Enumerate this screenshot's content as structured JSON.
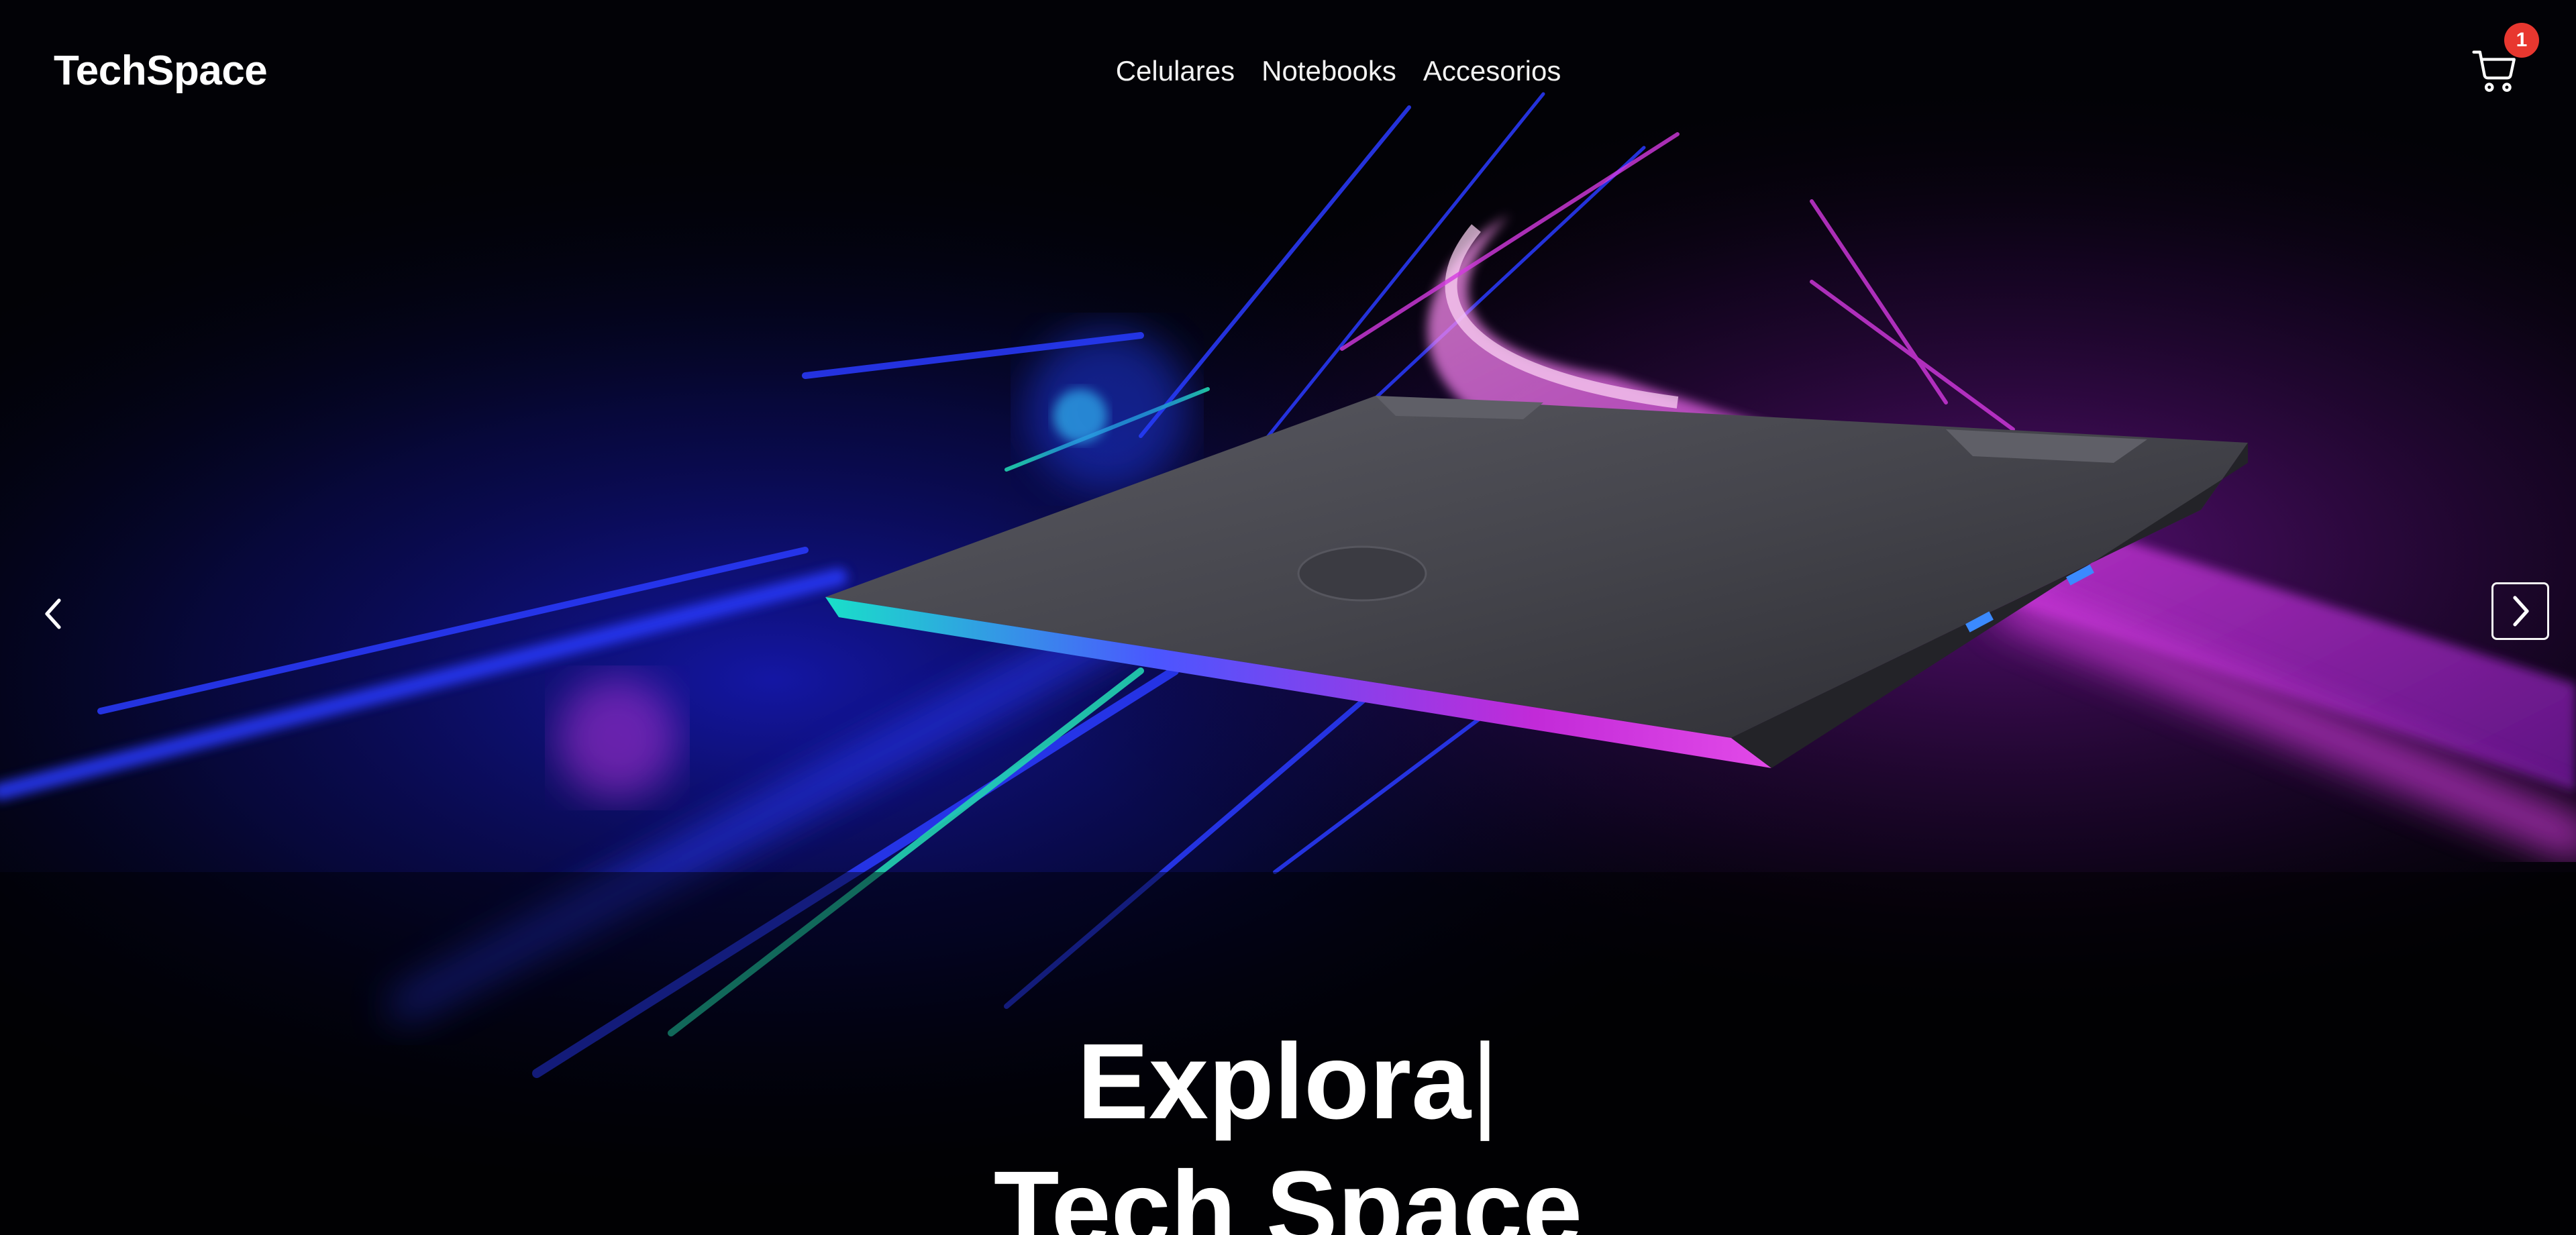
{
  "header": {
    "brand": "TechSpace",
    "nav": [
      "Celulares",
      "Notebooks",
      "Accesorios"
    ],
    "cart_count": "1"
  },
  "hero": {
    "line1": "Explora",
    "caret": "|",
    "line2": "Tech Space"
  },
  "icons": {
    "cart": "cart-icon",
    "prev": "chevron-left-icon",
    "next": "chevron-right-icon"
  },
  "colors": {
    "background": "#000000",
    "text": "#ffffff",
    "badge": "#e8372f",
    "accent_purple": "#c026d3",
    "accent_blue": "#2a3bff",
    "accent_teal": "#22d3b0"
  }
}
